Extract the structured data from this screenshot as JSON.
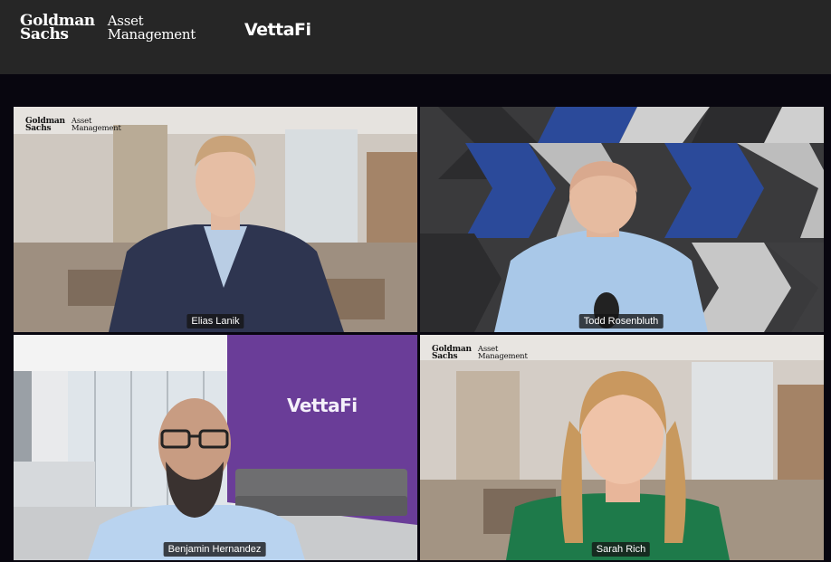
{
  "header": {
    "gs_logo_line1": "Goldman",
    "gs_logo_line2": "Sachs",
    "am_logo_line1": "Asset",
    "am_logo_line2": "Management",
    "partner_logo": "VettaFi"
  },
  "tiles": [
    {
      "name": "Elias Lanik",
      "logo_line1": "Goldman",
      "logo_line2": "Sachs",
      "logo_line3": "Asset",
      "logo_line4": "Management"
    },
    {
      "name": "Todd Rosenbluth"
    },
    {
      "name": "Benjamin Hernandez",
      "wall_logo": "VettaFi"
    },
    {
      "name": "Sarah Rich",
      "logo_line1": "Goldman",
      "logo_line2": "Sachs",
      "logo_line3": "Asset",
      "logo_line4": "Management"
    }
  ],
  "colors": {
    "topbar": "#262626",
    "page_background": "#08060f",
    "purple_wall": "#6a3d98",
    "chevron_blue": "#2b4a9a"
  }
}
